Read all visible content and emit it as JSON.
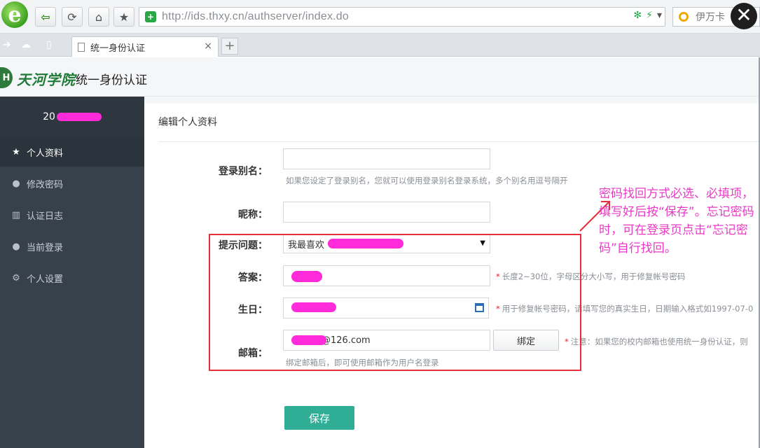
{
  "browser": {
    "url": "http://ids.thxy.cn/authserver/index.do",
    "search_text": "伊万卡",
    "tab_title": "统一身份认证",
    "new_tab_label": "+",
    "close_label": "×",
    "close_overlay_label": "✕"
  },
  "header": {
    "logo_badge": "H",
    "logo_script": "天河学院",
    "title": "统一身份认证"
  },
  "sidebar": {
    "user_prefix": "20",
    "items": [
      {
        "label": "个人资料",
        "icon": "star-icon",
        "glyph": "★",
        "active": true
      },
      {
        "label": "修改密码",
        "icon": "user-icon",
        "glyph": "👤",
        "active": false
      },
      {
        "label": "认证日志",
        "icon": "book-icon",
        "glyph": "📖",
        "active": false
      },
      {
        "label": "当前登录",
        "icon": "user-key-icon",
        "glyph": "👤",
        "active": false
      },
      {
        "label": "个人设置",
        "icon": "gear-icon",
        "glyph": "⚙",
        "active": false
      }
    ]
  },
  "form": {
    "section_title": "编辑个人资料",
    "alias_label": "登录别名：",
    "alias_hint": "如果您设定了登录别名，您就可以使用登录别名登录系统，多个别名用逗号隔开",
    "nickname_label": "昵称：",
    "question_label": "提示问题：",
    "question_value": "我最喜欢",
    "answer_label": "答案：",
    "answer_hint": "长度2~30位，字母区分大小写，用于修复帐号密码",
    "birthday_label": "生日：",
    "birthday_hint": "用于修复帐号密码，请填写您的真实生日，日期输入格式如1997-07-0",
    "email_label": "邮箱：",
    "email_value": "@126.com",
    "bind_button": "绑定",
    "email_hint": "注意：如果您的校内邮箱也使用统一身份认证，则",
    "email_sub_hint": "绑定邮箱后，即可使用邮箱作为用户名登录",
    "required_mark": "*",
    "save_button": "保存"
  },
  "annotation": {
    "text": "密码找回方式必选、必填项，填写好后按“保存”。忘记密码时，可在登录页点击“忘记密码”自行找回。"
  },
  "colors": {
    "sidebar_bg": "#37414b",
    "save_button": "#2fae95",
    "annotation": "#e93ac6",
    "highlight_box": "#e3303a",
    "redaction": "#ff2ad9"
  }
}
